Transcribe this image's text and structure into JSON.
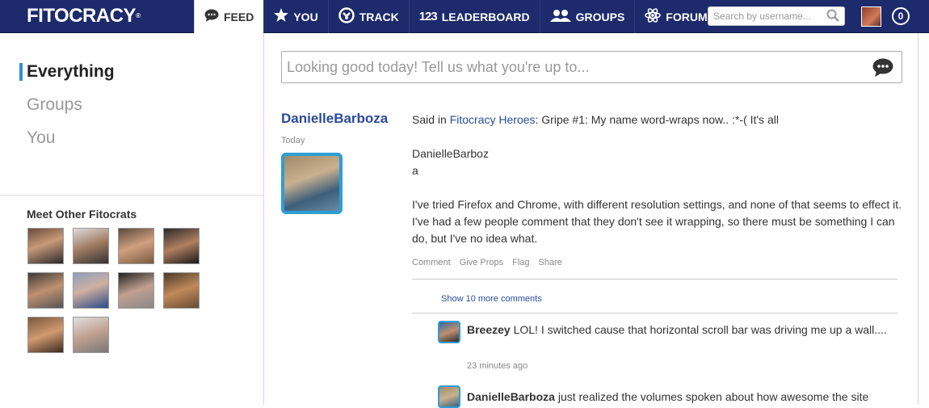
{
  "brand": {
    "logo": "FITOCRACY",
    "trademark": "®"
  },
  "nav": {
    "items": [
      {
        "label": "FEED",
        "icon": "speech-bubble-icon"
      },
      {
        "label": "YOU",
        "icon": "star-icon"
      },
      {
        "label": "TRACK",
        "icon": "kettlebell-icon"
      },
      {
        "label": "LEADERBOARD",
        "icon": "numbers-icon",
        "prefix": "123"
      },
      {
        "label": "GROUPS",
        "icon": "people-icon"
      },
      {
        "label": "FORUM",
        "icon": "atom-icon"
      }
    ],
    "active": "FEED"
  },
  "search": {
    "placeholder": "Search by username..."
  },
  "notifications": {
    "count": "0"
  },
  "sidebar": {
    "feed_types": [
      {
        "label": "Everything",
        "active": true
      },
      {
        "label": "Groups",
        "active": false
      },
      {
        "label": "You",
        "active": false
      }
    ],
    "meet_title": "Meet Other Fitocrats",
    "fitocrat_count": 10
  },
  "status_box": {
    "placeholder": "Looking good today! Tell us what you're up to..."
  },
  "post": {
    "author": "DanielleBarboza",
    "when": "Today",
    "said_in_prefix": "Said in ",
    "group_link": "Fitocracy Heroes",
    "said_in_suffix": ": Gripe #1: My name word-wraps now.. :*-( It's all",
    "line_name_1": "DanielleBarboz",
    "line_name_2": "a",
    "paragraph": "I've tried Firefox and Chrome, with different resolution settings, and none of that seems to effect it. I've had a few people comment that they don't see it wrapping, so there must be something I can do, but I've no idea what.",
    "actions": [
      "Comment",
      "Give Props",
      "Flag",
      "Share"
    ],
    "show_more": "Show 10 more comments"
  },
  "comments": [
    {
      "author": "Breezey",
      "text": "LOL! I switched cause that horizontal scroll bar was driving me up a wall....",
      "time": "23 minutes ago"
    },
    {
      "author": "DanielleBarboza",
      "text": "just realized the volumes spoken about how awesome the site",
      "time": ""
    }
  ],
  "colors": {
    "topbar": "#1d2a6b",
    "accent": "#2e9ed6",
    "link": "#2b4a9c"
  }
}
